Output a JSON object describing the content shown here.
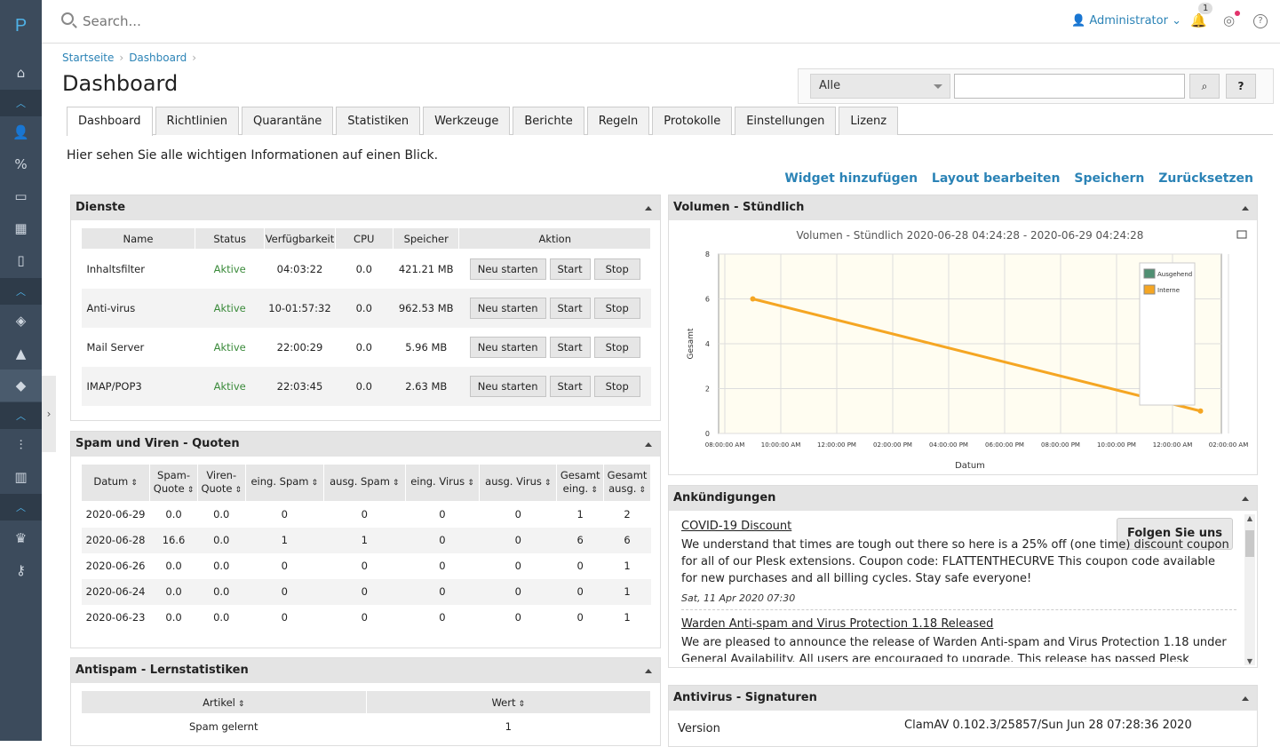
{
  "logo": "P",
  "search": {
    "placeholder": "Search..."
  },
  "user": {
    "name": "Administrator",
    "notif_count": "1"
  },
  "breadcrumb": [
    "Startseite",
    "Dashboard"
  ],
  "page_title": "Dashboard",
  "filter": {
    "selected": "Alle",
    "help": "?"
  },
  "tabs": [
    "Dashboard",
    "Richtlinien",
    "Quarantäne",
    "Statistiken",
    "Werkzeuge",
    "Berichte",
    "Regeln",
    "Protokolle",
    "Einstellungen",
    "Lizenz"
  ],
  "intro": "Hier sehen Sie alle wichtigen Informationen auf einen Blick.",
  "actions": [
    "Widget hinzufügen",
    "Layout bearbeiten",
    "Speichern",
    "Zurücksetzen"
  ],
  "dienste": {
    "title": "Dienste",
    "headers": [
      "Name",
      "Status",
      "Verfügbarkeit",
      "CPU",
      "Speicher",
      "Aktion"
    ],
    "buttons": {
      "restart": "Neu starten",
      "start": "Start",
      "stop": "Stop"
    },
    "rows": [
      [
        "Inhaltsfilter",
        "Aktive",
        "04:03:22",
        "0.0",
        "421.21 MB"
      ],
      [
        "Anti-virus",
        "Aktive",
        "10-01:57:32",
        "0.0",
        "962.53 MB"
      ],
      [
        "Mail Server",
        "Aktive",
        "22:00:29",
        "0.0",
        "5.96 MB"
      ],
      [
        "IMAP/POP3",
        "Aktive",
        "22:03:45",
        "0.0",
        "2.63 MB"
      ]
    ]
  },
  "quoten": {
    "title": "Spam und Viren - Quoten",
    "headers": [
      [
        "Datum"
      ],
      [
        "Spam-",
        "Quote"
      ],
      [
        "Viren-",
        "Quote"
      ],
      [
        "eing. Spam"
      ],
      [
        "ausg. Spam"
      ],
      [
        "eing. Virus"
      ],
      [
        "ausg. Virus"
      ],
      [
        "Gesamt",
        "eing."
      ],
      [
        "Gesamt",
        "ausg."
      ]
    ],
    "rows": [
      [
        "2020-06-29",
        "0.0",
        "0.0",
        "0",
        "0",
        "0",
        "0",
        "1",
        "2"
      ],
      [
        "2020-06-28",
        "16.6",
        "0.0",
        "1",
        "1",
        "0",
        "0",
        "6",
        "6"
      ],
      [
        "2020-06-26",
        "0.0",
        "0.0",
        "0",
        "0",
        "0",
        "0",
        "0",
        "1"
      ],
      [
        "2020-06-24",
        "0.0",
        "0.0",
        "0",
        "0",
        "0",
        "0",
        "0",
        "1"
      ],
      [
        "2020-06-23",
        "0.0",
        "0.0",
        "0",
        "0",
        "0",
        "0",
        "0",
        "1"
      ]
    ]
  },
  "lern": {
    "title": "Antispam - Lernstatistiken",
    "headers": [
      "Artikel",
      "Wert"
    ],
    "rows": [
      [
        "Spam gelernt",
        "1"
      ]
    ]
  },
  "volumen": {
    "title": "Volumen - Stündlich"
  },
  "chart_data": {
    "type": "line",
    "title": "Volumen - Stündlich 2020-06-28 04:24:28 - 2020-06-29 04:24:28",
    "xlabel": "Datum",
    "ylabel": "Gesamt",
    "ylim": [
      0,
      8
    ],
    "yticks": [
      0,
      2,
      4,
      6,
      8
    ],
    "xticks": [
      "08:00:00 AM",
      "10:00:00 AM",
      "12:00:00 PM",
      "02:00:00 PM",
      "04:00:00 PM",
      "06:00:00 PM",
      "08:00:00 PM",
      "10:00:00 PM",
      "12:00:00 AM",
      "02:00:00 AM"
    ],
    "legend_position": "top-right",
    "series": [
      {
        "name": "Ausgehend",
        "color": "#4f8f72",
        "x": [],
        "y": []
      },
      {
        "name": "Interne",
        "color": "#f5a623",
        "x": [
          "2020-06-28 09:00",
          "2020-06-29 01:00"
        ],
        "y": [
          6,
          1
        ]
      }
    ]
  },
  "ank": {
    "title": "Ankündigungen",
    "follow": "Folgen Sie uns",
    "items": [
      {
        "title": "COVID-19 Discount",
        "body": "We understand that times are tough out there so here is a 25% off (one time) discount coupon for all of our Plesk extensions. Coupon code: FLATTENTHECURVE This coupon code available for new purchases and all billing cycles. Stay safe everyone!",
        "date": "Sat, 11 Apr 2020 07:30"
      },
      {
        "title": "Warden Anti-spam and Virus Protection 1.18 Released",
        "body": "We are pleased to announce the release of Warden Anti-spam and Virus Protection 1.18 under General Availability. All users are encouraged to upgrade. This release has passed Plesk certification"
      }
    ]
  },
  "sig": {
    "title": "Antivirus - Signaturen",
    "label": "Version",
    "value": "ClamAV 0.102.3/25857/Sun Jun 28 07:28:36 2020"
  }
}
